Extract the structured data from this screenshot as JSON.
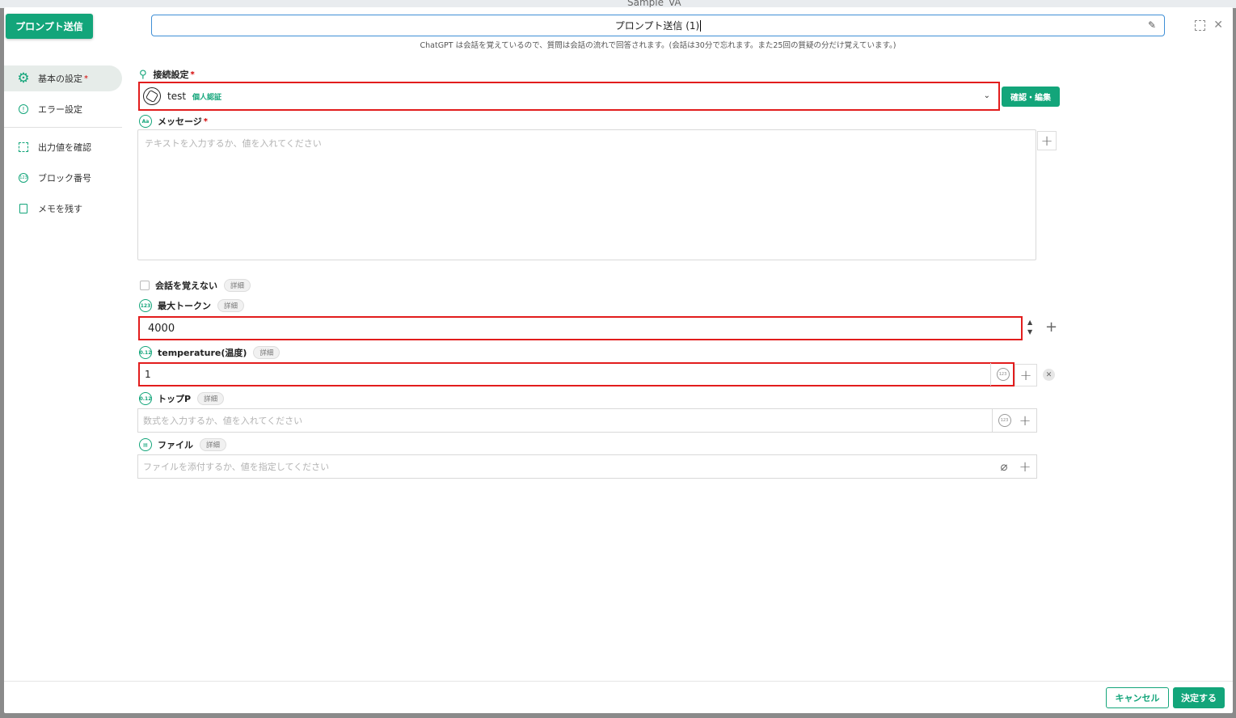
{
  "background": {
    "ghost_title": "Sample_VA"
  },
  "header": {
    "block_button": "プロンプト送信",
    "title_value": "プロンプト送信 (1)",
    "note": "ChatGPT は会話を覚えているので、質問は会話の流れで回答されます。(会話は30分で忘れます。また25回の質疑の分だけ覚えています。)"
  },
  "sidebar": {
    "items": [
      {
        "label": "基本の設定",
        "required": "*",
        "icon": "gear-icon"
      },
      {
        "label": "エラー設定",
        "icon": "alert-circle-icon"
      },
      {
        "label": "出力値を確認",
        "icon": "frame-icon"
      },
      {
        "label": "ブロック番号",
        "icon": "number-circle-icon"
      },
      {
        "label": "メモを残す",
        "icon": "memo-icon"
      }
    ]
  },
  "form": {
    "connection": {
      "label": "接続設定",
      "required": "*",
      "value": "test",
      "badge": "個人認証",
      "confirm_button": "確認・編集"
    },
    "message": {
      "label": "メッセージ",
      "required": "*",
      "placeholder": "テキストを入力するか、値を入れてください"
    },
    "no_memory": {
      "label": "会話を覚えない",
      "detail": "詳細"
    },
    "max_tokens": {
      "label": "最大トークン",
      "detail": "詳細",
      "value": "4000"
    },
    "temperature": {
      "label": "temperature(温度)",
      "detail": "詳細",
      "value": "1"
    },
    "top_p": {
      "label": "トップP",
      "detail": "詳細",
      "placeholder": "数式を入力するか、値を入れてください"
    },
    "file": {
      "label": "ファイル",
      "detail": "詳細",
      "placeholder": "ファイルを添付するか、値を指定してください"
    }
  },
  "footer": {
    "cancel": "キャンセル",
    "ok": "決定する"
  },
  "colors": {
    "accent": "#13a57a",
    "highlight": "#e21d1d",
    "focus": "#3f8fd6"
  }
}
